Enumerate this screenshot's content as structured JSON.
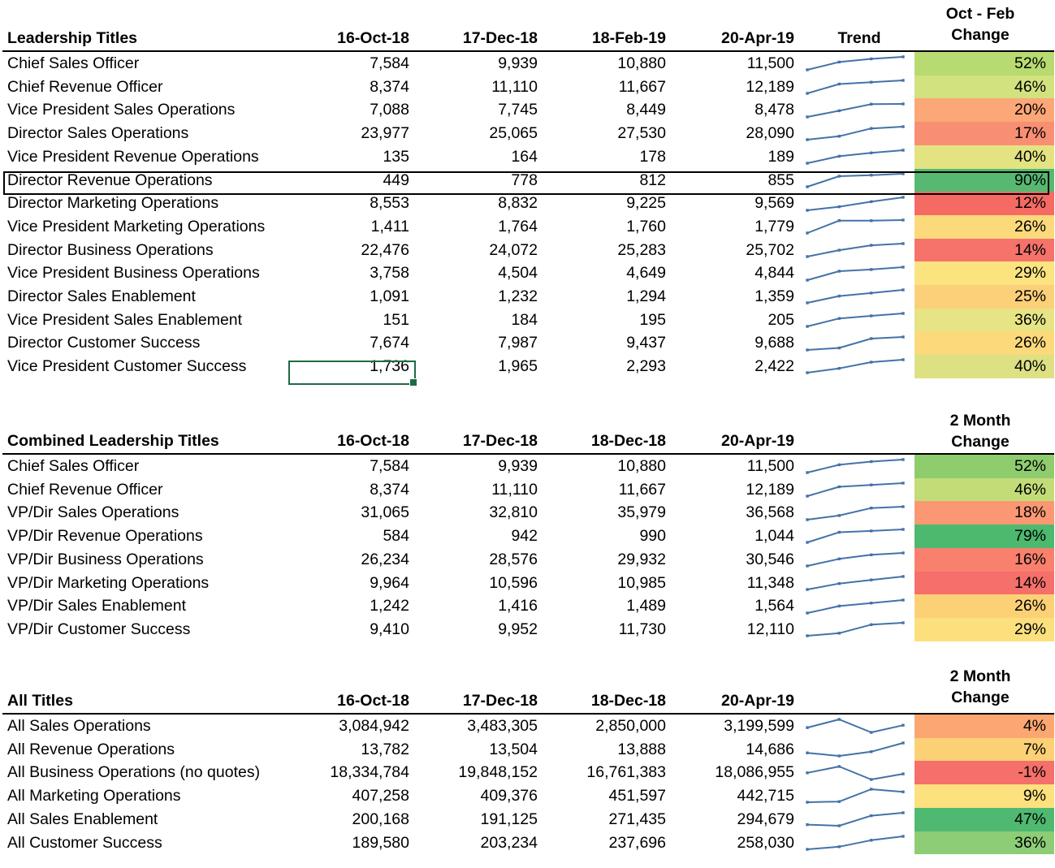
{
  "accent_colors": {
    "sparkline": "#4472a8",
    "selection_green": "#1e6b43",
    "outline_black": "#000000"
  },
  "tables": [
    {
      "id": "leadership-titles",
      "title_header": "Leadership Titles",
      "date_headers": [
        "16-Oct-18",
        "17-Dec-18",
        "18-Feb-19",
        "20-Apr-19"
      ],
      "trend_header": "Trend",
      "change_header_line1": "Oct - Feb",
      "change_header_line2": "Change",
      "rows": [
        {
          "label": "Chief Sales Officer",
          "values": [
            "7,584",
            "9,939",
            "10,880",
            "11,500"
          ],
          "nums": [
            7584,
            9939,
            10880,
            11500
          ],
          "change": "52%",
          "color": "#b7db70"
        },
        {
          "label": "Chief Revenue Officer",
          "values": [
            "8,374",
            "11,110",
            "11,667",
            "12,189"
          ],
          "nums": [
            8374,
            11110,
            11667,
            12189
          ],
          "change": "46%",
          "color": "#d2e27f"
        },
        {
          "label": "Vice President Sales Operations",
          "values": [
            "7,088",
            "7,745",
            "8,449",
            "8,478"
          ],
          "nums": [
            7088,
            7745,
            8449,
            8478
          ],
          "change": "20%",
          "color": "#fca777"
        },
        {
          "label": "Director Sales Operations",
          "values": [
            "23,977",
            "25,065",
            "27,530",
            "28,090"
          ],
          "nums": [
            23977,
            25065,
            27530,
            28090
          ],
          "change": "17%",
          "color": "#f98f72"
        },
        {
          "label": "Vice President Revenue Operations",
          "values": [
            "135",
            "164",
            "178",
            "189"
          ],
          "nums": [
            135,
            164,
            178,
            189
          ],
          "change": "40%",
          "color": "#e3e382"
        },
        {
          "label": "Director Revenue Operations",
          "values": [
            "449",
            "778",
            "812",
            "855"
          ],
          "nums": [
            449,
            778,
            812,
            855
          ],
          "change": "90%",
          "color": "#57b971"
        },
        {
          "label": "Director Marketing Operations",
          "values": [
            "8,553",
            "8,832",
            "9,225",
            "9,569"
          ],
          "nums": [
            8553,
            8832,
            9225,
            9569
          ],
          "change": "12%",
          "color": "#f56b64"
        },
        {
          "label": "Vice President Marketing Operations",
          "values": [
            "1,411",
            "1,764",
            "1,760",
            "1,779"
          ],
          "nums": [
            1411,
            1764,
            1760,
            1779
          ],
          "change": "26%",
          "color": "#fcd97b"
        },
        {
          "label": "Director Business Operations",
          "values": [
            "22,476",
            "24,072",
            "25,283",
            "25,702"
          ],
          "nums": [
            22476,
            24072,
            25283,
            25702
          ],
          "change": "14%",
          "color": "#f5736a"
        },
        {
          "label": "Vice President Business Operations",
          "values": [
            "3,758",
            "4,504",
            "4,649",
            "4,844"
          ],
          "nums": [
            3758,
            4504,
            4649,
            4844
          ],
          "change": "29%",
          "color": "#fbe480"
        },
        {
          "label": "Director Sales Enablement",
          "values": [
            "1,091",
            "1,232",
            "1,294",
            "1,359"
          ],
          "nums": [
            1091,
            1232,
            1294,
            1359
          ],
          "change": "25%",
          "color": "#fcd079"
        },
        {
          "label": "Vice President Sales Enablement",
          "values": [
            "151",
            "184",
            "195",
            "205"
          ],
          "nums": [
            151,
            184,
            195,
            205
          ],
          "change": "36%",
          "color": "#e6e484"
        },
        {
          "label": "Director Customer Success",
          "values": [
            "7,674",
            "7,987",
            "9,437",
            "9,688"
          ],
          "nums": [
            7674,
            7987,
            9437,
            9688
          ],
          "change": "26%",
          "color": "#fcd97b"
        },
        {
          "label": "Vice President Customer Success",
          "values": [
            "1,736",
            "1,965",
            "2,293",
            "2,422"
          ],
          "nums": [
            1736,
            1965,
            2293,
            2422
          ],
          "change": "40%",
          "color": "#dde184"
        }
      ]
    },
    {
      "id": "combined-leadership-titles",
      "title_header": "Combined Leadership Titles",
      "date_headers": [
        "16-Oct-18",
        "17-Dec-18",
        "18-Dec-18",
        "20-Apr-19"
      ],
      "trend_header": "",
      "change_header_line1": "2 Month",
      "change_header_line2": "Change",
      "rows": [
        {
          "label": "Chief Sales Officer",
          "values": [
            "7,584",
            "9,939",
            "10,880",
            "11,500"
          ],
          "nums": [
            7584,
            9939,
            10880,
            11500
          ],
          "change": "52%",
          "color": "#8fcc6e"
        },
        {
          "label": "Chief Revenue Officer",
          "values": [
            "8,374",
            "11,110",
            "11,667",
            "12,189"
          ],
          "nums": [
            8374,
            11110,
            11667,
            12189
          ],
          "change": "46%",
          "color": "#c2dd78"
        },
        {
          "label": "VP/Dir Sales Operations",
          "values": [
            "31,065",
            "32,810",
            "35,979",
            "36,568"
          ],
          "nums": [
            31065,
            32810,
            35979,
            36568
          ],
          "change": "18%",
          "color": "#fb9873"
        },
        {
          "label": "VP/Dir Revenue Operations",
          "values": [
            "584",
            "942",
            "990",
            "1,044"
          ],
          "nums": [
            584,
            942,
            990,
            1044
          ],
          "change": "79%",
          "color": "#4cb96e"
        },
        {
          "label": "VP/Dir Business Operations",
          "values": [
            "26,234",
            "28,576",
            "29,932",
            "30,546"
          ],
          "nums": [
            26234,
            28576,
            29932,
            30546
          ],
          "change": "16%",
          "color": "#f9806d"
        },
        {
          "label": "VP/Dir Marketing Operations",
          "values": [
            "9,964",
            "10,596",
            "10,985",
            "11,348"
          ],
          "nums": [
            9964,
            10596,
            10985,
            11348
          ],
          "change": "14%",
          "color": "#f5706a"
        },
        {
          "label": "VP/Dir Sales Enablement",
          "values": [
            "1,242",
            "1,416",
            "1,489",
            "1,564"
          ],
          "nums": [
            1242,
            1416,
            1489,
            1564
          ],
          "change": "26%",
          "color": "#fcd176"
        },
        {
          "label": "VP/Dir Customer Success",
          "values": [
            "9,410",
            "9,952",
            "11,730",
            "12,110"
          ],
          "nums": [
            9410,
            9952,
            11730,
            12110
          ],
          "change": "29%",
          "color": "#fce07e"
        }
      ]
    },
    {
      "id": "all-titles",
      "title_header": "All Titles",
      "date_headers": [
        "16-Oct-18",
        "17-Dec-18",
        "18-Dec-18",
        "20-Apr-19"
      ],
      "trend_header": "",
      "change_header_line1": "2 Month",
      "change_header_line2": "Change",
      "rows": [
        {
          "label": "All Sales Operations",
          "values": [
            "3,084,942",
            "3,483,305",
            "2,850,000",
            "3,199,599"
          ],
          "nums": [
            3084942,
            3483305,
            2850000,
            3199599
          ],
          "change": "4%",
          "color": "#fca771"
        },
        {
          "label": "All Revenue Operations",
          "values": [
            "13,782",
            "13,504",
            "13,888",
            "14,686"
          ],
          "nums": [
            13782,
            13504,
            13888,
            14686
          ],
          "change": "7%",
          "color": "#fcd176"
        },
        {
          "label": "All Business Operations (no quotes)",
          "values": [
            "18,334,784",
            "19,848,152",
            "16,761,383",
            "18,086,955"
          ],
          "nums": [
            18334784,
            19848152,
            16761383,
            18086955
          ],
          "change": "-1%",
          "color": "#f5706a"
        },
        {
          "label": "All Marketing Operations",
          "values": [
            "407,258",
            "409,376",
            "451,597",
            "442,715"
          ],
          "nums": [
            407258,
            409376,
            451597,
            442715
          ],
          "change": "9%",
          "color": "#fce17e"
        },
        {
          "label": "All Sales Enablement",
          "values": [
            "200,168",
            "191,125",
            "271,435",
            "294,679"
          ],
          "nums": [
            200168,
            191125,
            271435,
            294679
          ],
          "change": "47%",
          "color": "#4fb971"
        },
        {
          "label": "All Customer Success",
          "values": [
            "189,580",
            "203,234",
            "237,696",
            "258,030"
          ],
          "nums": [
            189580,
            203234,
            237696,
            258030
          ],
          "change": "36%",
          "color": "#8ccd76"
        }
      ]
    }
  ],
  "selection": {
    "selected_cell_value": "1,736",
    "outlined_row_label": "Director Revenue Operations"
  }
}
